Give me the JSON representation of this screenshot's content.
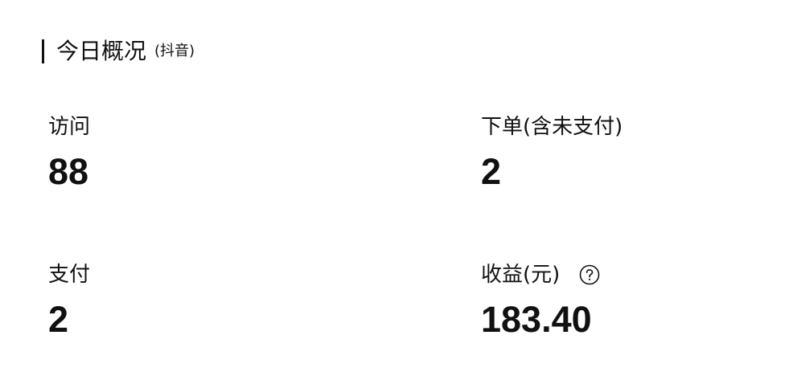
{
  "overview": {
    "title": "今日概况",
    "platform": "(抖音)"
  },
  "metrics": {
    "visits": {
      "label": "访问",
      "value": "88"
    },
    "orders": {
      "label": "下单(含未支付)",
      "value": "2"
    },
    "paid": {
      "label": "支付",
      "value": "2"
    },
    "revenue": {
      "label": "收益(元)",
      "value": "183.40",
      "help_icon": "question-circle-icon"
    }
  }
}
